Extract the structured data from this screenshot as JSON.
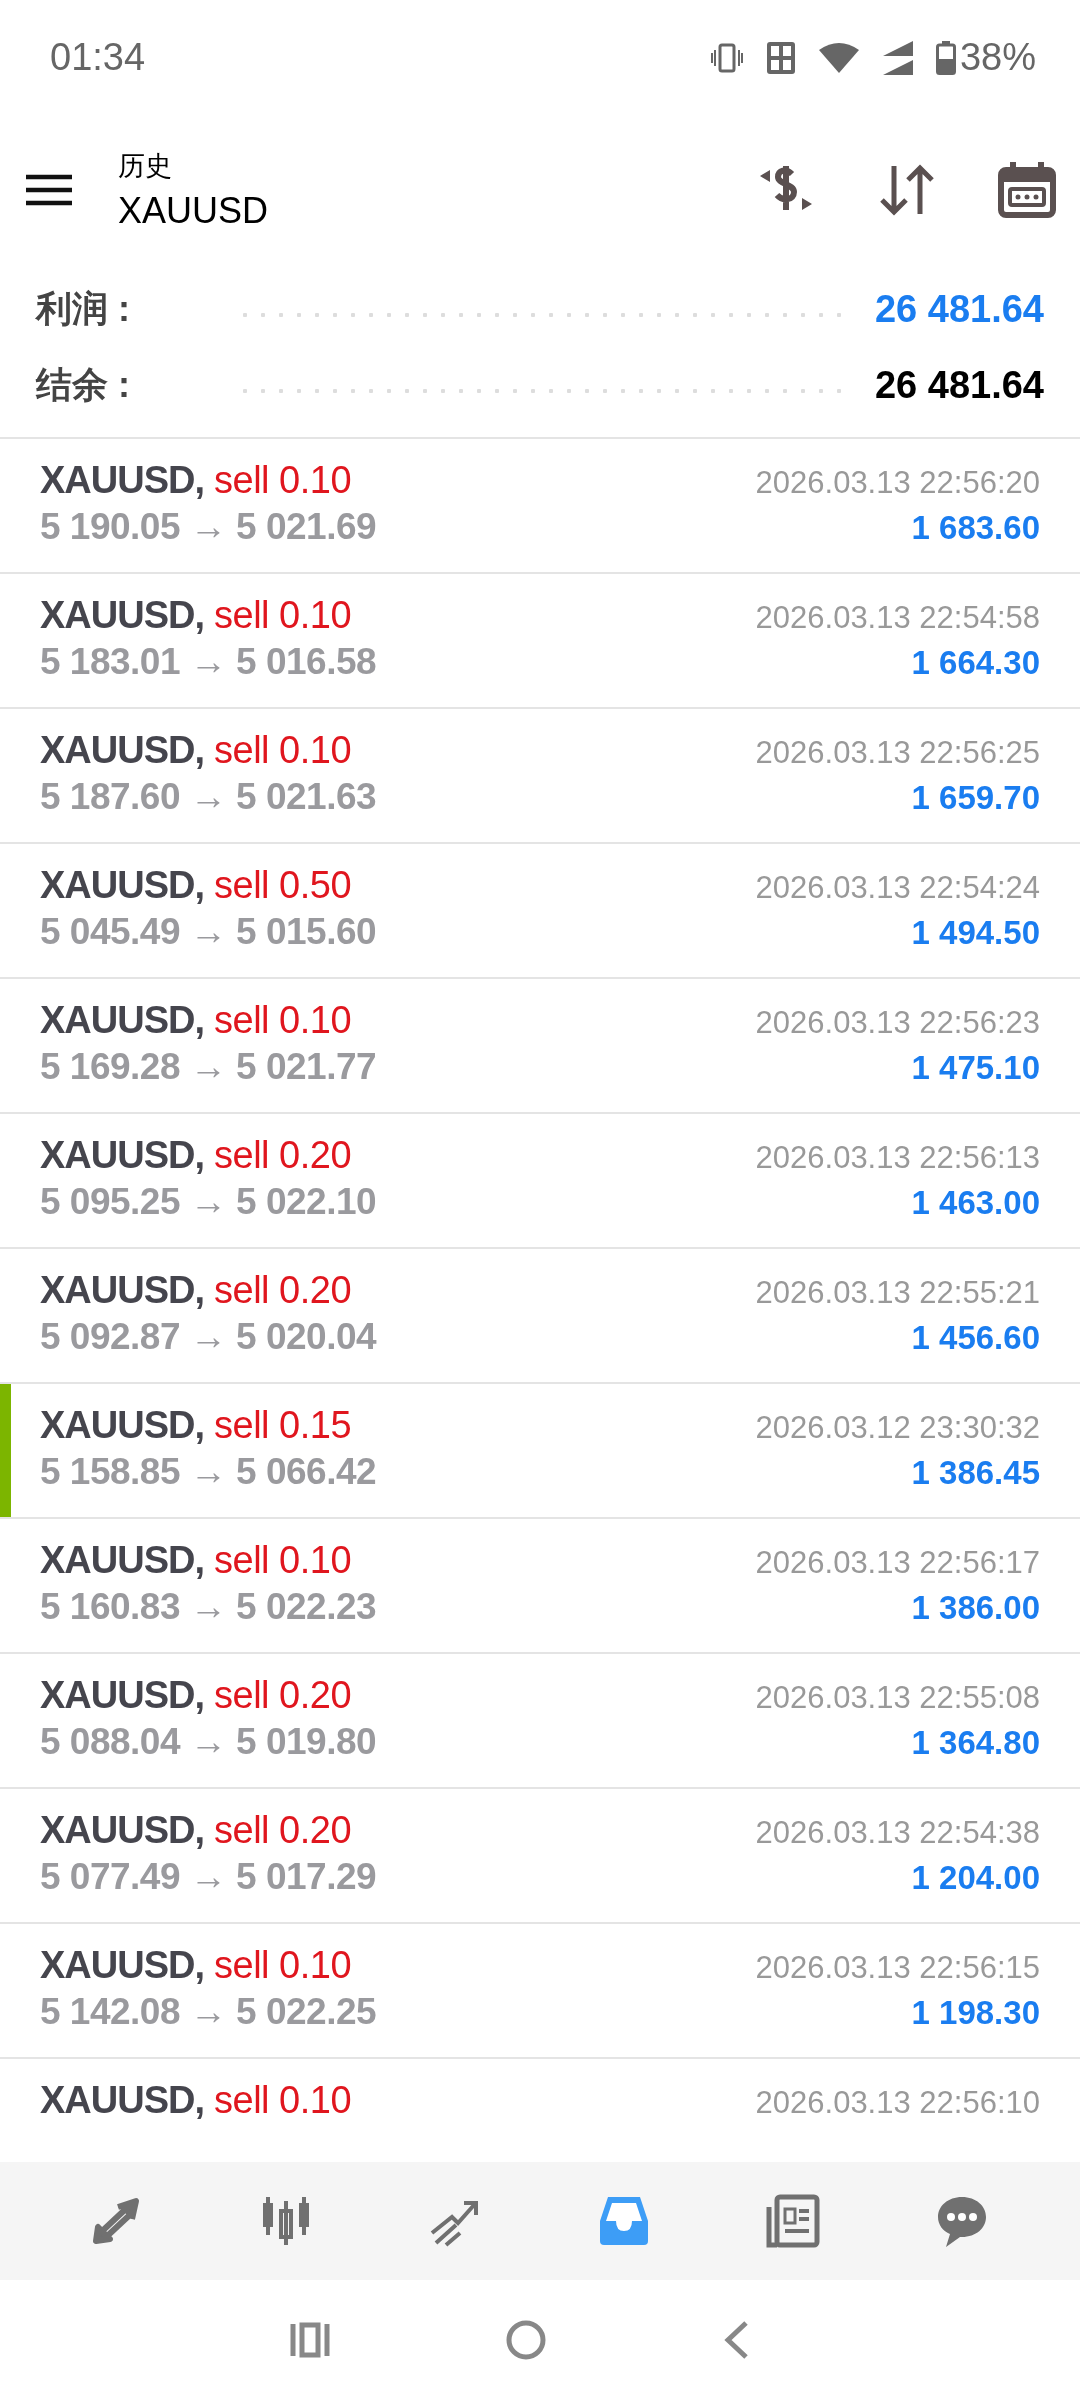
{
  "status_bar": {
    "time": "01:34",
    "battery": "38%"
  },
  "header": {
    "subtitle": "历史",
    "title": "XAUUSD"
  },
  "summary": [
    {
      "label": "利润 :",
      "value": "26 481.64",
      "kind": "profit"
    },
    {
      "label": "结余 :",
      "value": "26 481.64",
      "kind": "balance"
    }
  ],
  "deals": [
    {
      "symbol": "XAUUSD,",
      "side": "sell 0.10",
      "time": "2026.03.13 22:56:20",
      "prices": "5 190.05 → 5 021.69",
      "profit": "1 683.60",
      "marked": false
    },
    {
      "symbol": "XAUUSD,",
      "side": "sell 0.10",
      "time": "2026.03.13 22:54:58",
      "prices": "5 183.01 → 5 016.58",
      "profit": "1 664.30",
      "marked": false
    },
    {
      "symbol": "XAUUSD,",
      "side": "sell 0.10",
      "time": "2026.03.13 22:56:25",
      "prices": "5 187.60 → 5 021.63",
      "profit": "1 659.70",
      "marked": false
    },
    {
      "symbol": "XAUUSD,",
      "side": "sell 0.50",
      "time": "2026.03.13 22:54:24",
      "prices": "5 045.49 → 5 015.60",
      "profit": "1 494.50",
      "marked": false
    },
    {
      "symbol": "XAUUSD,",
      "side": "sell 0.10",
      "time": "2026.03.13 22:56:23",
      "prices": "5 169.28 → 5 021.77",
      "profit": "1 475.10",
      "marked": false
    },
    {
      "symbol": "XAUUSD,",
      "side": "sell 0.20",
      "time": "2026.03.13 22:56:13",
      "prices": "5 095.25 → 5 022.10",
      "profit": "1 463.00",
      "marked": false
    },
    {
      "symbol": "XAUUSD,",
      "side": "sell 0.20",
      "time": "2026.03.13 22:55:21",
      "prices": "5 092.87 → 5 020.04",
      "profit": "1 456.60",
      "marked": false
    },
    {
      "symbol": "XAUUSD,",
      "side": "sell 0.15",
      "time": "2026.03.12 23:30:32",
      "prices": "5 158.85 → 5 066.42",
      "profit": "1 386.45",
      "marked": true
    },
    {
      "symbol": "XAUUSD,",
      "side": "sell 0.10",
      "time": "2026.03.13 22:56:17",
      "prices": "5 160.83 → 5 022.23",
      "profit": "1 386.00",
      "marked": false
    },
    {
      "symbol": "XAUUSD,",
      "side": "sell 0.20",
      "time": "2026.03.13 22:55:08",
      "prices": "5 088.04 → 5 019.80",
      "profit": "1 364.80",
      "marked": false
    },
    {
      "symbol": "XAUUSD,",
      "side": "sell 0.20",
      "time": "2026.03.13 22:54:38",
      "prices": "5 077.49 → 5 017.29",
      "profit": "1 204.00",
      "marked": false
    },
    {
      "symbol": "XAUUSD,",
      "side": "sell 0.10",
      "time": "2026.03.13 22:56:15",
      "prices": "5 142.08 → 5 022.25",
      "profit": "1 198.30",
      "marked": false
    },
    {
      "symbol": "XAUUSD,",
      "side": "sell 0.10",
      "time": "2026.03.13 22:56:10",
      "marked": false
    }
  ],
  "bottom_nav": [
    {
      "kind": "trade",
      "selected": false
    },
    {
      "kind": "chart",
      "selected": false
    },
    {
      "kind": "trend",
      "selected": false
    },
    {
      "kind": "history",
      "selected": true
    },
    {
      "kind": "news",
      "selected": false
    },
    {
      "kind": "chat",
      "selected": false
    }
  ]
}
